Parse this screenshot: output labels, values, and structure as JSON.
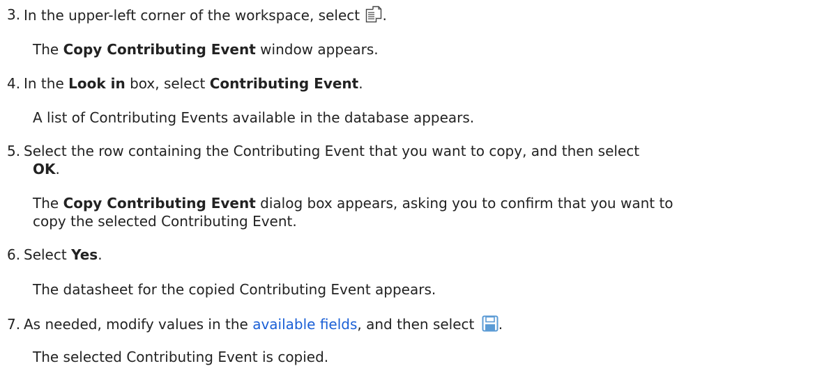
{
  "steps": [
    {
      "number": "3.",
      "parts": [
        "In the upper-left corner of the workspace, select ",
        "."
      ],
      "result": "The ",
      "result_bold": "Copy Contributing Event",
      "result_tail": " window appears."
    },
    {
      "number": "4.",
      "a": "In the ",
      "a_bold": "Look in",
      "b": " box, select ",
      "b_bold": "Contributing Event",
      "c": ".",
      "result": "A list of Contributing Events available in the database appears."
    },
    {
      "number": "5.",
      "text": "Select the row containing the Contributing Event that you want to copy, and then select",
      "text_bold": "OK",
      "text_tail": ".",
      "result_a": "The ",
      "result_bold": "Copy Contributing Event",
      "result_b": " dialog box appears, asking you to confirm that you want to",
      "result_line2": "copy the selected Contributing Event."
    },
    {
      "number": "6.",
      "a": "Select ",
      "a_bold": "Yes",
      "b": ".",
      "result": "The datasheet for the copied Contributing Event appears."
    },
    {
      "number": "7.",
      "a": "As needed, modify values in the ",
      "link": "available fields",
      "b": ", and then select ",
      "c": ".",
      "result": "The selected Contributing Event is copied."
    }
  ],
  "icons": {
    "copy": "copy-document-icon",
    "save": "save-icon"
  },
  "colors": {
    "text": "#222222",
    "link": "#1a5fd6",
    "save_icon": "#5b9bd5"
  }
}
